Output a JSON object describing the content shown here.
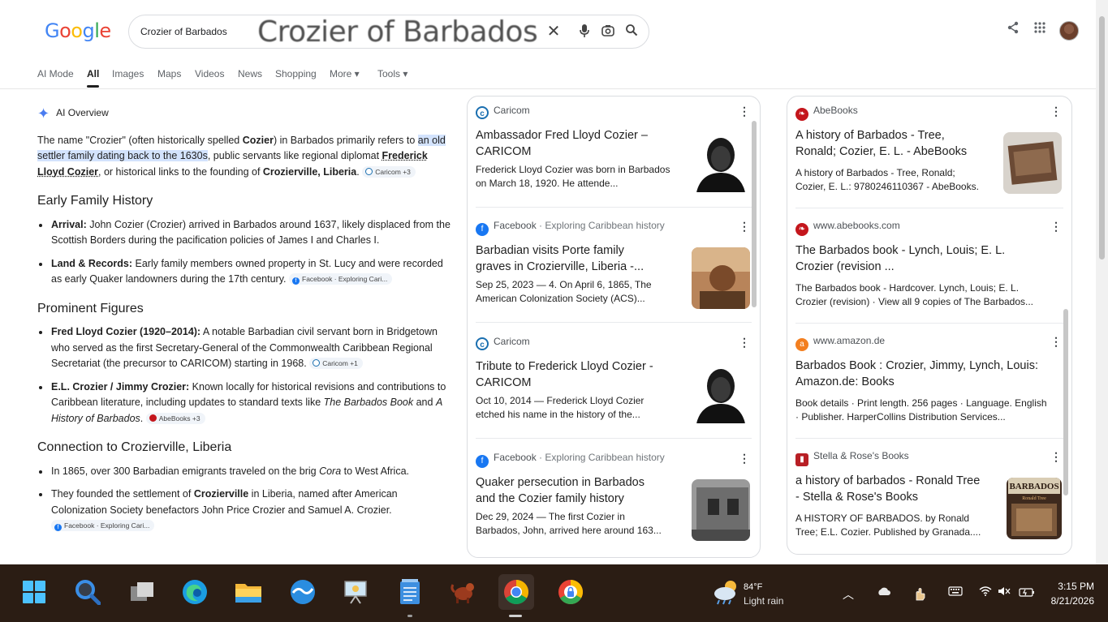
{
  "header": {
    "logo": [
      "G",
      "o",
      "o",
      "g",
      "l",
      "e"
    ],
    "logo_colors": [
      "#4285f4",
      "#ea4335",
      "#fbbc05",
      "#4285f4",
      "#34a853",
      "#ea4335"
    ],
    "query": "Crozier of Barbados",
    "magnified_query": "Crozier of Barbados"
  },
  "tabs": [
    "AI Mode",
    "All",
    "Images",
    "Maps",
    "Videos",
    "News",
    "Shopping",
    "More ▾",
    "Tools ▾"
  ],
  "ai_overview": {
    "label": "AI Overview",
    "intro": {
      "t1": "The name \"Crozier\" (often historically spelled ",
      "b1": "Cozier",
      "t2": ") in Barbados primarily refers to ",
      "hl": "an old settler family dating back to the 1630s",
      "t3": ", public servants like regional diplomat ",
      "ul": "Frederick Lloyd Cozier",
      "t4": ", or historical links to the founding of ",
      "b2": "Crozierville, Liberia",
      "t5": ".",
      "chip": "Caricom +3"
    },
    "sections": [
      {
        "heading": "Early Family History",
        "items": [
          {
            "bold": "Arrival:",
            "text": " John Cozier (Crozier) arrived in Barbados around 1637, likely displaced from the Scottish Borders during the pacification policies of James I and Charles I."
          },
          {
            "bold": "Land & Records:",
            "text": " Early family members owned property in St. Lucy and were recorded as early Quaker landowners during the 17th century.",
            "chip": "Facebook · Exploring Cari..."
          }
        ]
      },
      {
        "heading": "Prominent Figures",
        "items": [
          {
            "bold": "Fred Lloyd Cozier (1920–2014):",
            "text": " A notable Barbadian civil servant born in Bridgetown who served as the first Secretary-General of the Commonwealth Caribbean Regional Secretariat (the precursor to CARICOM) starting in 1968.",
            "chip": "Caricom +1"
          },
          {
            "bold": "E.L. Crozier / Jimmy Crozier:",
            "text": " Known locally for historical revisions and contributions to Caribbean literature, including updates to standard texts like ",
            "i1": "The Barbados Book",
            "t2": " and ",
            "i2": "A History of Barbados",
            "t3": ".",
            "chip": "AbeBooks +3"
          }
        ]
      },
      {
        "heading": "Connection to Crozierville, Liberia",
        "items": [
          {
            "text": "In 1865, over 300 Barbadian emigrants traveled on the brig ",
            "i1": "Cora",
            "t2": " to West Africa."
          },
          {
            "text": "They founded the settlement of ",
            "bold2": "Crozierville",
            "t2": " in Liberia, named after American Colonization Society benefactors John Price Crozier and Samuel A. Crozier.",
            "chip": "Facebook · Exploring Cari..."
          }
        ]
      }
    ]
  },
  "middle_cards": [
    {
      "source": "Caricom",
      "sub": "",
      "title": "Ambassador Fred Lloyd Cozier – CARICOM",
      "snippet": "Frederick Lloyd Cozier was born in Barbados on March 18, 1920. He attende..."
    },
    {
      "source": "Facebook",
      "sub": "Exploring Caribbean history",
      "title": "Barbadian visits Porte family graves in Crozierville, Liberia -...",
      "snippet": "Sep 25, 2023 — 4. On April 6, 1865, The American Colonization Society (ACS)..."
    },
    {
      "source": "Caricom",
      "sub": "",
      "title": "Tribute to Frederick Lloyd Cozier - CARICOM",
      "snippet": "Oct 10, 2014 — Frederick Lloyd Cozier etched his name in the history of the..."
    },
    {
      "source": "Facebook",
      "sub": "Exploring Caribbean history",
      "title": "Quaker persecution in Barbados and the Cozier family history",
      "snippet": "Dec 29, 2024 — The first Cozier in Barbados, John, arrived here around 163..."
    }
  ],
  "right_cards": [
    {
      "source": "AbeBooks",
      "title": "A history of Barbados - Tree, Ronald; Cozier, E. L. - AbeBooks",
      "snippet": "A history of Barbados - Tree, Ronald; Cozier, E. L.: 9780246110367 - AbeBooks."
    },
    {
      "source": "www.abebooks.com",
      "title": "The Barbados book - Lynch, Louis; E. L. Crozier (revision ...",
      "snippet": "The Barbados book - Hardcover. Lynch, Louis; E. L. Crozier (revision) · View all 9 copies of The Barbados..."
    },
    {
      "source": "www.amazon.de",
      "title": "Barbados Book : Crozier, Jimmy, Lynch, Louis: Amazon.de: Books",
      "snippet": "Book details · Print length. 256 pages · Language. English · Publisher. HarperCollins Distribution Services..."
    },
    {
      "source": "Stella & Rose's Books",
      "title": "a history of barbados - Ronald Tree - Stella & Rose's Books",
      "snippet": "A HISTORY OF BARBADOS. by Ronald Tree; E.L. Cozier. Published by Granada...."
    }
  ],
  "thumb_text": {
    "barbados": "BARBADOS",
    "barbados_sub": "Ronald Tree"
  },
  "taskbar": {
    "weather_temp": "84°F",
    "weather_desc": "Light rain",
    "time": "3:15 PM",
    "date": "8/21/2026"
  }
}
